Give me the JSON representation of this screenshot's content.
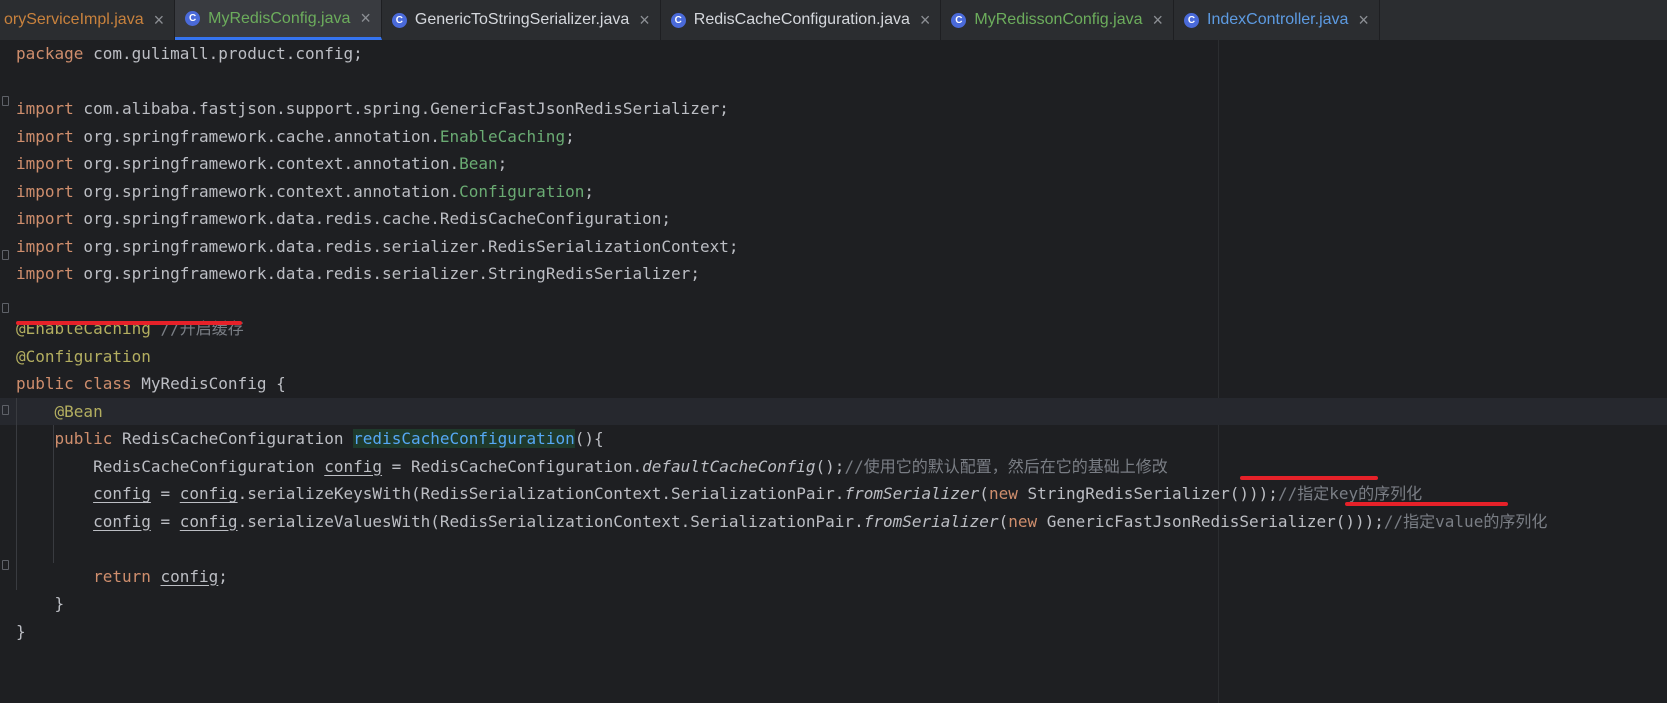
{
  "tabs": [
    {
      "name": "oryServiceImpl.java",
      "state": "modified",
      "active": false
    },
    {
      "name": "MyRedisConfig.java",
      "state": "green",
      "active": true
    },
    {
      "name": "GenericToStringSerializer.java",
      "state": "plain",
      "active": false
    },
    {
      "name": "RedisCacheConfiguration.java",
      "state": "plain",
      "active": false
    },
    {
      "name": "MyRedissonConfig.java",
      "state": "green",
      "active": false
    },
    {
      "name": "IndexController.java",
      "state": "blue",
      "active": false
    }
  ],
  "icons": {
    "class_icon": "C",
    "close_icon": "×"
  },
  "code": {
    "package_kw": "package",
    "package_name": " com.gulimall.product.config;",
    "imports": [
      {
        "kw": "import",
        "path": " com.alibaba.fastjson.support.spring.",
        "name": "GenericFastJsonRedisSerializer",
        "anno": false
      },
      {
        "kw": "import",
        "path": " org.springframework.cache.annotation.",
        "name": "EnableCaching",
        "anno": true
      },
      {
        "kw": "import",
        "path": " org.springframework.context.annotation.",
        "name": "Bean",
        "anno": true
      },
      {
        "kw": "import",
        "path": " org.springframework.context.annotation.",
        "name": "Configuration",
        "anno": true
      },
      {
        "kw": "import",
        "path": " org.springframework.data.redis.cache.",
        "name": "RedisCacheConfiguration",
        "anno": false
      },
      {
        "kw": "import",
        "path": " org.springframework.data.redis.serializer.",
        "name": "RedisSerializationContext",
        "anno": false
      },
      {
        "kw": "import",
        "path": " org.springframework.data.redis.serializer.",
        "name": "StringRedisSerializer",
        "anno": false
      }
    ],
    "enable_caching_anno": "@EnableCaching",
    "enable_caching_comment": "//开启缓存",
    "configuration_anno": "@Configuration",
    "class_decl_kw": "public class",
    "class_decl_name": " MyRedisConfig {",
    "bean_anno": "@Bean",
    "method_kw": "public",
    "method_type": " RedisCacheConfiguration ",
    "method_name": "redisCacheConfiguration",
    "method_tail": "(){",
    "line1_type": "RedisCacheConfiguration ",
    "var_config": "config",
    "line1_mid": " = RedisCacheConfiguration.",
    "line1_static": "defaultCacheConfig",
    "line1_end": "();",
    "line1_comment": "//使用它的默认配置，然后在它的基础上修改",
    "assign_eq": " = ",
    "line2_call": ".serializeKeysWith(RedisSerializationContext.SerializationPair.",
    "from_serializer": "fromSerializer",
    "line2_open": "(",
    "new_kw": "new",
    "line2_arg": " StringRedisSerializer()));",
    "line2_comment": "//指定key的序列化",
    "line3_call": ".serializeValuesWith(RedisSerializationContext.SerializationPair.",
    "line3_arg": " GenericFastJsonRedisSerializer()));",
    "line3_comment": "//指定value的序列化",
    "return_kw": "return",
    "return_tail": ";",
    "close_method": "}",
    "close_class": "}"
  }
}
